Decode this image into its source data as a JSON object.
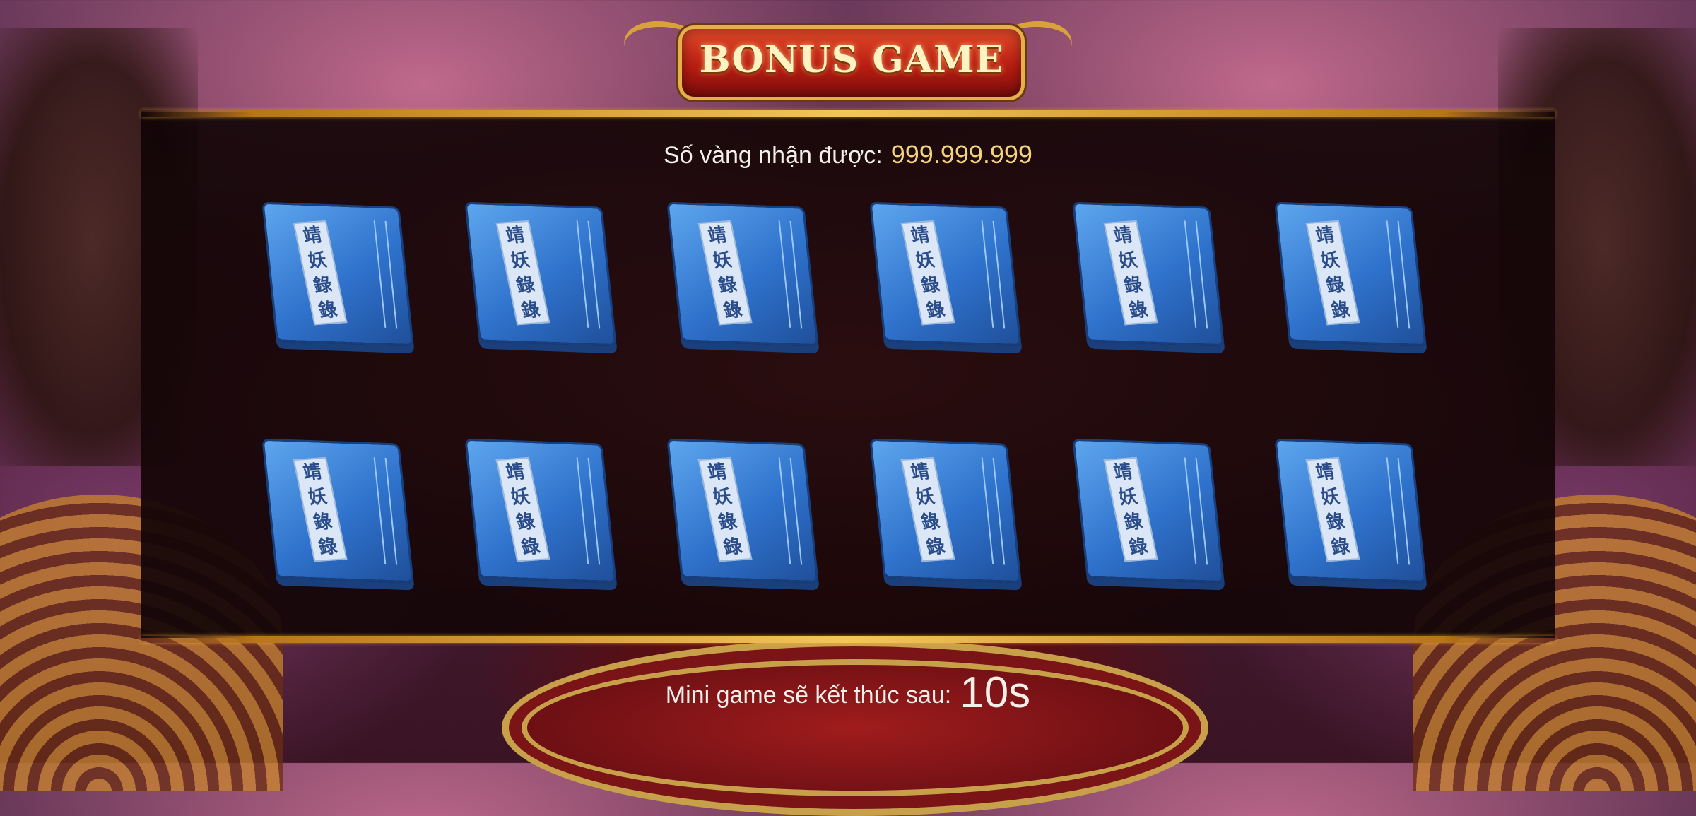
{
  "banner": {
    "title": "BONUS GAME"
  },
  "reward": {
    "label": "Số vàng nhận được:",
    "value": "999.999.999"
  },
  "books": [
    {
      "chars": [
        "靖",
        "妖",
        "錄",
        "錄"
      ]
    },
    {
      "chars": [
        "靖",
        "妖",
        "錄",
        "錄"
      ]
    },
    {
      "chars": [
        "靖",
        "妖",
        "錄",
        "錄"
      ]
    },
    {
      "chars": [
        "靖",
        "妖",
        "錄",
        "錄"
      ]
    },
    {
      "chars": [
        "靖",
        "妖",
        "錄",
        "錄"
      ]
    },
    {
      "chars": [
        "靖",
        "妖",
        "錄",
        "錄"
      ]
    },
    {
      "chars": [
        "靖",
        "妖",
        "錄",
        "錄"
      ]
    },
    {
      "chars": [
        "靖",
        "妖",
        "錄",
        "錄"
      ]
    },
    {
      "chars": [
        "靖",
        "妖",
        "錄",
        "錄"
      ]
    },
    {
      "chars": [
        "靖",
        "妖",
        "錄",
        "錄"
      ]
    },
    {
      "chars": [
        "靖",
        "妖",
        "錄",
        "錄"
      ]
    },
    {
      "chars": [
        "靖",
        "妖",
        "錄",
        "錄"
      ]
    }
  ],
  "footer": {
    "label": "Mini game sẽ kết thúc sau:",
    "seconds": "10s"
  },
  "colors": {
    "gold": "#f2d27a",
    "bookBlue": "#2f72cc",
    "bannerRed": "#b81d12"
  }
}
